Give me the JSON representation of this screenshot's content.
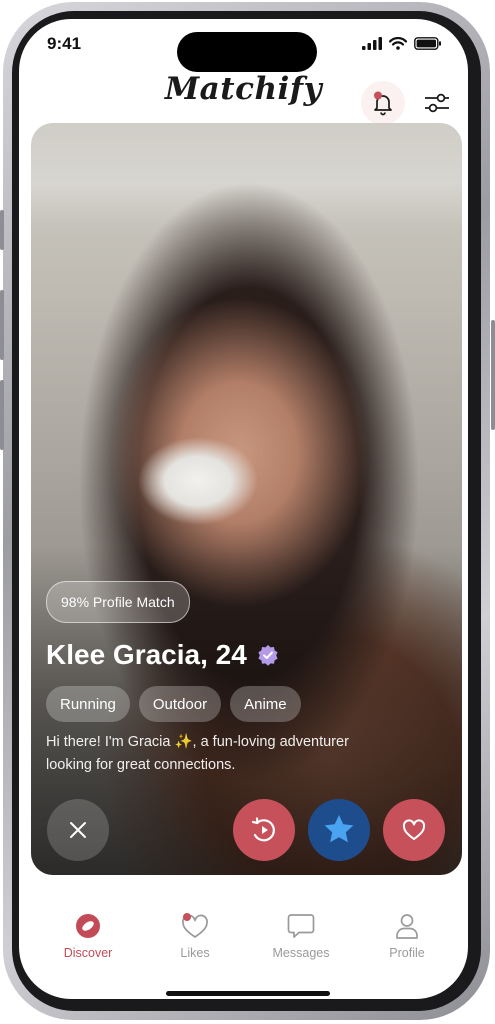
{
  "status_bar": {
    "time": "9:41"
  },
  "app": {
    "title": "Matchify"
  },
  "profile": {
    "match": "98% Profile Match",
    "name": "Klee Gracia, 24",
    "tags": [
      "Running",
      "Outdoor",
      "Anime"
    ],
    "bio": "Hi there! I'm Gracia ✨, a fun-loving adventurer looking for great connections."
  },
  "actions": [
    "close-icon",
    "undo-icon",
    "star-icon",
    "heart-icon"
  ],
  "nav": {
    "items": [
      {
        "label": "Discover",
        "icon": "discover-icon",
        "active": true
      },
      {
        "label": "Likes",
        "icon": "likes-icon",
        "active": false
      },
      {
        "label": "Messages",
        "icon": "messages-icon",
        "active": false
      },
      {
        "label": "Profile",
        "icon": "profile-icon",
        "active": false
      }
    ]
  },
  "colors": {
    "accent": "#c6515b",
    "star": "#1e4d8e"
  }
}
